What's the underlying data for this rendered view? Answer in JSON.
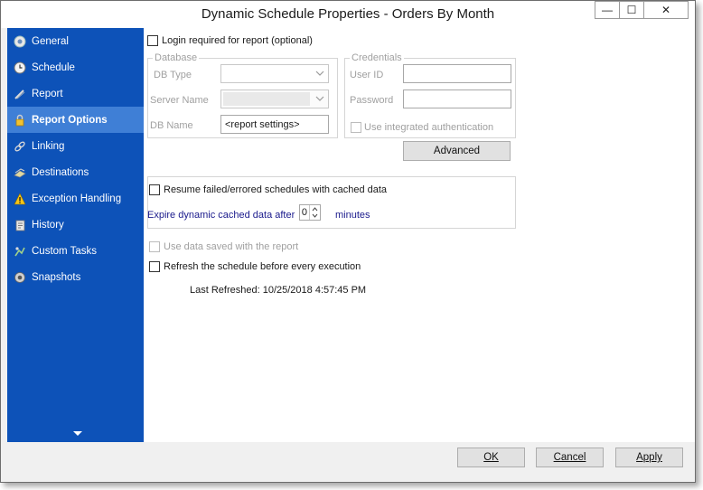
{
  "window": {
    "title": "Dynamic Schedule Properties - Orders By Month",
    "minimize_glyph": "—",
    "maximize_glyph": "☐",
    "close_glyph": "✕"
  },
  "sidebar": {
    "items": [
      {
        "label": "General",
        "icon": "general-icon"
      },
      {
        "label": "Schedule",
        "icon": "clock-icon"
      },
      {
        "label": "Report",
        "icon": "report-icon"
      },
      {
        "label": "Report Options",
        "icon": "lock-icon",
        "active": true
      },
      {
        "label": "Linking",
        "icon": "link-icon"
      },
      {
        "label": "Destinations",
        "icon": "destinations-icon"
      },
      {
        "label": "Exception Handling",
        "icon": "warning-icon"
      },
      {
        "label": "History",
        "icon": "history-icon"
      },
      {
        "label": "Custom Tasks",
        "icon": "custom-tasks-icon"
      },
      {
        "label": "Snapshots",
        "icon": "snapshots-icon"
      }
    ]
  },
  "options": {
    "login_required_label": "Login required for report (optional)",
    "database_legend": "Database",
    "db_type_label": "DB Type",
    "db_type_value": "",
    "server_name_label": "Server Name",
    "server_name_value": "",
    "db_name_label": "DB Name",
    "db_name_value": "<report settings>",
    "credentials_legend": "Credentials",
    "user_id_label": "User ID",
    "user_id_value": "",
    "password_label": "Password",
    "password_value": "",
    "integrated_auth_label": "Use integrated authentication",
    "advanced_button": "Advanced",
    "resume_label": "Resume failed/errored schedules with cached data",
    "expire_label": "Expire dynamic cached data after",
    "expire_value": "0",
    "minutes_label": "minutes",
    "use_saved_data_label": "Use data saved with the report",
    "refresh_label": "Refresh the schedule before every execution",
    "last_refreshed": "Last Refreshed: 10/25/2018 4:57:45 PM"
  },
  "footer": {
    "ok_label": "OK",
    "cancel_label": "Cancel",
    "apply_label": "Apply"
  },
  "colors": {
    "sidebar_bg": "#0d52b8",
    "sidebar_active": "#3f7fd6"
  }
}
